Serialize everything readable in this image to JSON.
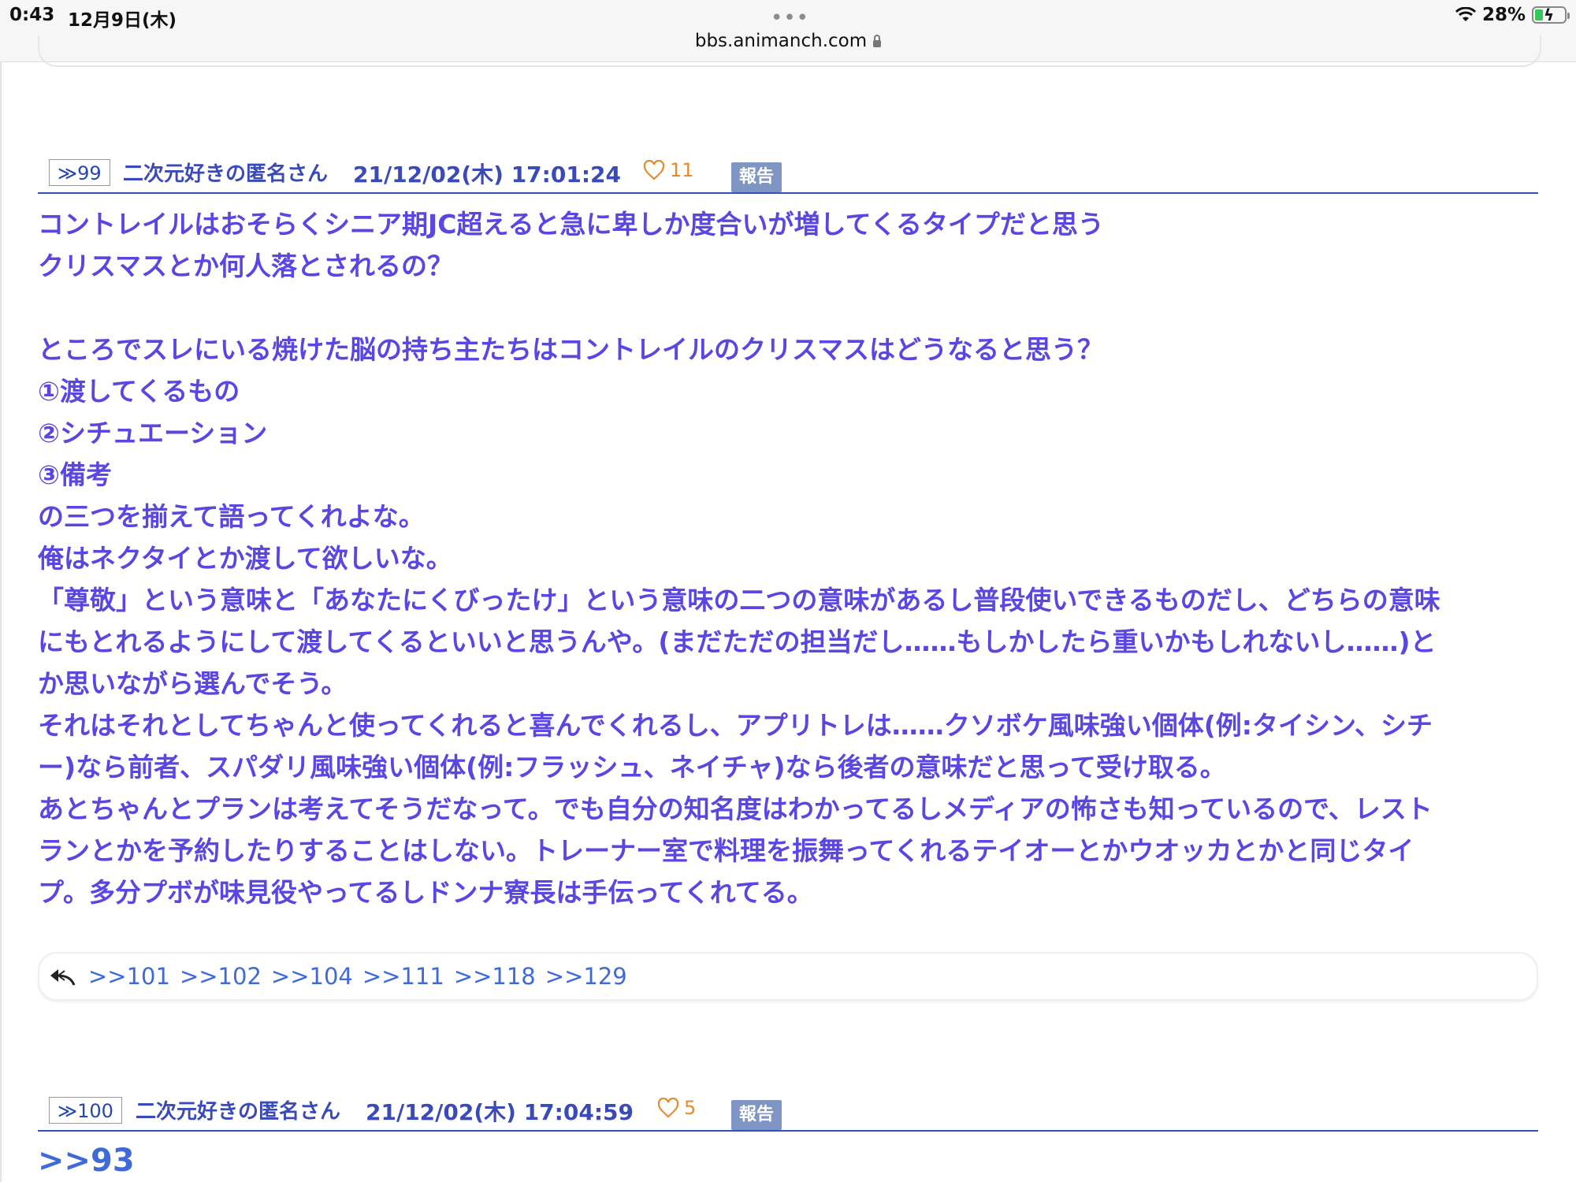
{
  "status_bar": {
    "time": "0:43",
    "date": "12月9日(木)",
    "dots": "•••",
    "url": "bbs.animanch.com",
    "battery_text": "28%",
    "battery_level": 0.28
  },
  "posts": [
    {
      "number": "≫99",
      "poster": "二次元好きの匿名さん",
      "datetime": "21/12/02(木) 17:01:24",
      "likes": "11",
      "report": "報告",
      "body_lines": [
        "コントレイルはおそらくシニア期JC超えると急に卑しか度合いが増してくるタイプだと思う",
        "クリスマスとか何人落とされるの？",
        "",
        "ところでスレにいる焼けた脳の持ち主たちはコントレイルのクリスマスはどうなると思う？",
        "①渡してくるもの",
        "②シチュエーション",
        "③備考",
        "の三つを揃えて語ってくれよな。",
        "俺はネクタイとか渡して欲しいな。",
        "「尊敬」という意味と「あなたにくびったけ」という意味の二つの意味があるし普段使いできるものだし、どちらの意味",
        "にもとれるようにして渡してくるといいと思うんや。(まだただの担当だし……もしかしたら重いかもしれないし……)と",
        "か思いながら選んでそう。",
        "それはそれとしてちゃんと使ってくれると喜んでくれるし、アプリトレは……クソボケ風味強い個体(例:タイシン、シチ",
        "ー)なら前者、スパダリ風味強い個体(例:フラッシュ、ネイチャ)なら後者の意味だと思って受け取る。",
        "あとちゃんとプランは考えてそうだなって。でも自分の知名度はわかってるしメディアの怖さも知っているので、レスト",
        "ランとかを予約したりすることはしない。トレーナー室で料理を振舞ってくれるテイオーとかウオッカとかと同じタイ",
        "プ。多分プボが味見役やってるしドンナ寮長は手伝ってくれてる。"
      ],
      "replies": [
        ">>101",
        ">>102",
        ">>104",
        ">>111",
        ">>118",
        ">>129"
      ]
    },
    {
      "number": "≫100",
      "poster": "二次元好きの匿名さん",
      "datetime": "21/12/02(木) 17:04:59",
      "likes": "5",
      "report": "報告",
      "quote": ">>93"
    }
  ],
  "colors": {
    "accent": "#3452b4",
    "body_text": "#5a46e0",
    "link": "#3f6ad7",
    "like": "#e68a2e",
    "report_bg": "#7f96c4"
  }
}
